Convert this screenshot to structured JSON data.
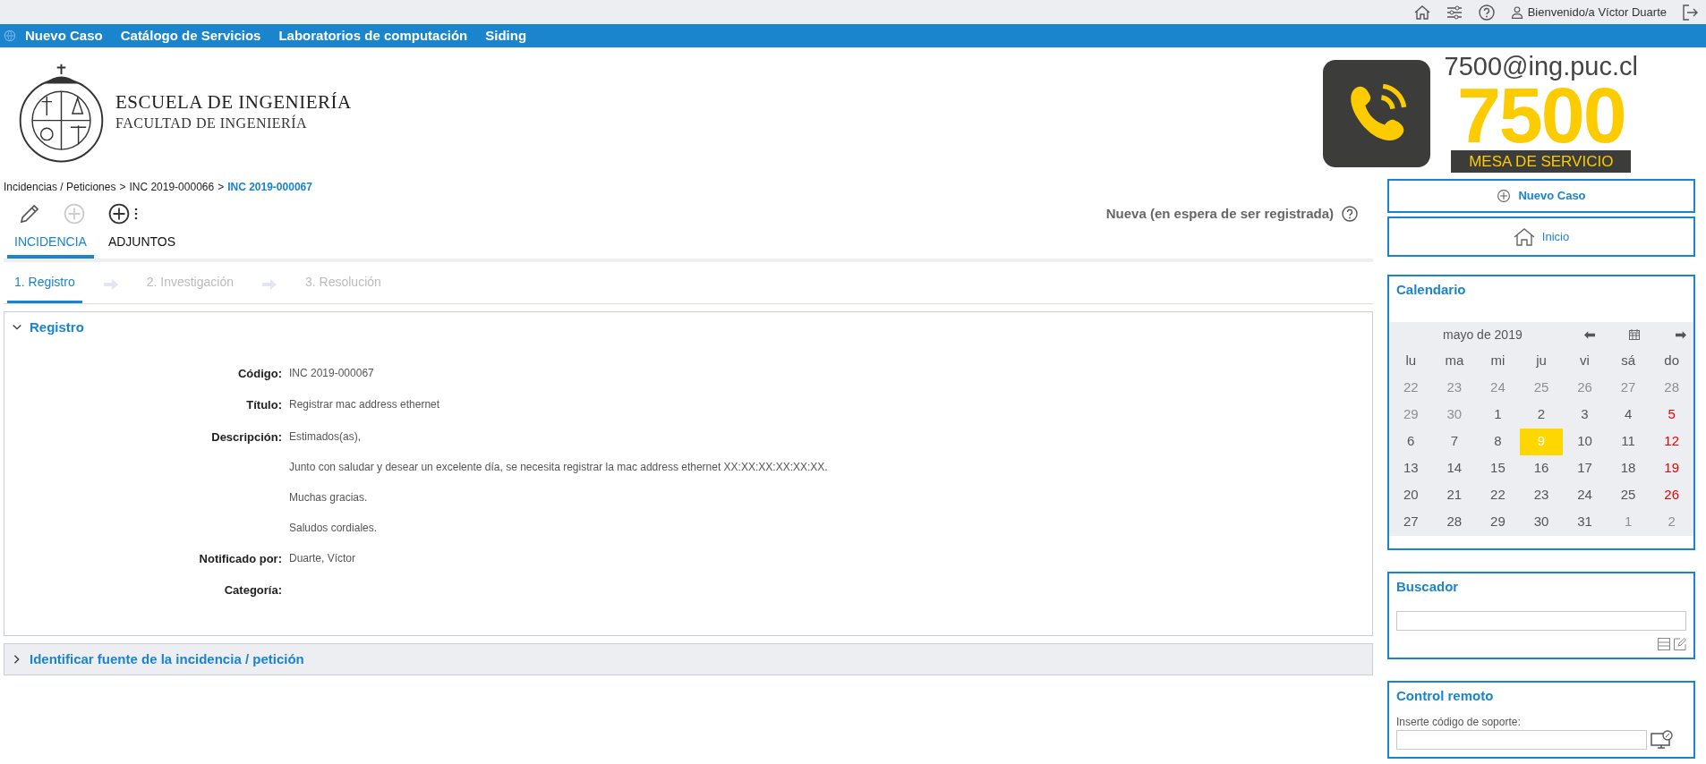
{
  "top_bar": {
    "greeting": "Bienvenido/a Víctor Duarte"
  },
  "nav": [
    {
      "label": "Nuevo Caso"
    },
    {
      "label": "Catálogo de Servicios"
    },
    {
      "label": "Laboratorios de computación"
    },
    {
      "label": "Siding"
    }
  ],
  "logo": {
    "title": "ESCUELA DE INGENIERÍA",
    "subtitle": "FACULTAD DE INGENIERÍA"
  },
  "service_banner": {
    "email": "7500@ing.puc.cl",
    "number": "7500",
    "caption": "MESA DE SERVICIO"
  },
  "breadcrumb": [
    {
      "label": "Incidencias / Peticiones",
      "current": false
    },
    {
      "label": "INC 2019-000066",
      "current": false
    },
    {
      "label": "INC 2019-000067",
      "current": true
    }
  ],
  "breadcrumb_separator": ">",
  "toolbar": [
    {
      "kind": "edit",
      "disabled": false
    },
    {
      "kind": "add",
      "disabled": true
    },
    {
      "kind": "add_menu",
      "disabled": false
    }
  ],
  "status": "Nueva (en espera de ser registrada)",
  "tabs": [
    {
      "label": "INCIDENCIA",
      "selected": true
    },
    {
      "label": "ADJUNTOS",
      "selected": false
    }
  ],
  "steps": [
    {
      "label": "1. Registro",
      "selected": true
    },
    {
      "label": "2. Investigación",
      "selected": false
    },
    {
      "label": "3. Resolución",
      "selected": false
    }
  ],
  "sections": [
    {
      "title": "Registro",
      "expanded": true,
      "fields": [
        {
          "label": "Código:",
          "lines": [
            "INC 2019-000067"
          ]
        },
        {
          "label": "Título:",
          "lines": [
            "Registrar mac address ethernet"
          ]
        },
        {
          "label": "Descripción:",
          "lines": [
            "Estimados(as),",
            "Junto con saludar y desear un excelente día, se necesita registrar la mac address ethernet XX:XX:XX:XX:XX:XX.",
            "Muchas gracias.",
            "Saludos cordiales."
          ]
        },
        {
          "label": "Notificado por:",
          "lines": [
            "Duarte, Víctor"
          ]
        },
        {
          "label": "Categoría:"
        }
      ]
    },
    {
      "title": "Identificar fuente de la incidencia / petición",
      "expanded": false
    }
  ],
  "sidebar": {
    "buttons": [
      {
        "kind": "new",
        "label": "Nuevo Caso"
      },
      {
        "kind": "home",
        "label": "Inicio"
      }
    ],
    "calendar": {
      "title": "Calendario",
      "month": "mayo de 2019",
      "weekdays": [
        "lu",
        "ma",
        "mi",
        "ju",
        "vi",
        "sá",
        "do"
      ],
      "weeks": [
        [
          {
            "day": "22",
            "outside": true,
            "holiday": false,
            "selected": false
          },
          {
            "day": "23",
            "outside": true,
            "holiday": false,
            "selected": false
          },
          {
            "day": "24",
            "outside": true,
            "holiday": false,
            "selected": false
          },
          {
            "day": "25",
            "outside": true,
            "holiday": false,
            "selected": false
          },
          {
            "day": "26",
            "outside": true,
            "holiday": false,
            "selected": false
          },
          {
            "day": "27",
            "outside": true,
            "holiday": false,
            "selected": false
          },
          {
            "day": "28",
            "outside": true,
            "holiday": false,
            "selected": false
          }
        ],
        [
          {
            "day": "29",
            "outside": true,
            "holiday": false,
            "selected": false
          },
          {
            "day": "30",
            "outside": true,
            "holiday": false,
            "selected": false
          },
          {
            "day": "1",
            "outside": false,
            "holiday": false,
            "selected": false
          },
          {
            "day": "2",
            "outside": false,
            "holiday": false,
            "selected": false
          },
          {
            "day": "3",
            "outside": false,
            "holiday": false,
            "selected": false
          },
          {
            "day": "4",
            "outside": false,
            "holiday": false,
            "selected": false
          },
          {
            "day": "5",
            "outside": false,
            "holiday": true,
            "selected": false
          }
        ],
        [
          {
            "day": "6",
            "outside": false,
            "holiday": false,
            "selected": false
          },
          {
            "day": "7",
            "outside": false,
            "holiday": false,
            "selected": false
          },
          {
            "day": "8",
            "outside": false,
            "holiday": false,
            "selected": false
          },
          {
            "day": "9",
            "outside": false,
            "holiday": false,
            "selected": true
          },
          {
            "day": "10",
            "outside": false,
            "holiday": false,
            "selected": false
          },
          {
            "day": "11",
            "outside": false,
            "holiday": false,
            "selected": false
          },
          {
            "day": "12",
            "outside": false,
            "holiday": true,
            "selected": false
          }
        ],
        [
          {
            "day": "13",
            "outside": false,
            "holiday": false,
            "selected": false
          },
          {
            "day": "14",
            "outside": false,
            "holiday": false,
            "selected": false
          },
          {
            "day": "15",
            "outside": false,
            "holiday": false,
            "selected": false
          },
          {
            "day": "16",
            "outside": false,
            "holiday": false,
            "selected": false
          },
          {
            "day": "17",
            "outside": false,
            "holiday": false,
            "selected": false
          },
          {
            "day": "18",
            "outside": false,
            "holiday": false,
            "selected": false
          },
          {
            "day": "19",
            "outside": false,
            "holiday": true,
            "selected": false
          }
        ],
        [
          {
            "day": "20",
            "outside": false,
            "holiday": false,
            "selected": false
          },
          {
            "day": "21",
            "outside": false,
            "holiday": false,
            "selected": false
          },
          {
            "day": "22",
            "outside": false,
            "holiday": false,
            "selected": false
          },
          {
            "day": "23",
            "outside": false,
            "holiday": false,
            "selected": false
          },
          {
            "day": "24",
            "outside": false,
            "holiday": false,
            "selected": false
          },
          {
            "day": "25",
            "outside": false,
            "holiday": false,
            "selected": false
          },
          {
            "day": "26",
            "outside": false,
            "holiday": true,
            "selected": false
          }
        ],
        [
          {
            "day": "27",
            "outside": false,
            "holiday": false,
            "selected": false
          },
          {
            "day": "28",
            "outside": false,
            "holiday": false,
            "selected": false
          },
          {
            "day": "29",
            "outside": false,
            "holiday": false,
            "selected": false
          },
          {
            "day": "30",
            "outside": false,
            "holiday": false,
            "selected": false
          },
          {
            "day": "31",
            "outside": false,
            "holiday": false,
            "selected": false
          },
          {
            "day": "1",
            "outside": true,
            "holiday": false,
            "selected": false
          },
          {
            "day": "2",
            "outside": true,
            "holiday": false,
            "selected": false
          }
        ]
      ]
    },
    "search": {
      "title": "Buscador"
    },
    "remote": {
      "title": "Control remoto",
      "label": "Inserte código de soporte:"
    }
  }
}
